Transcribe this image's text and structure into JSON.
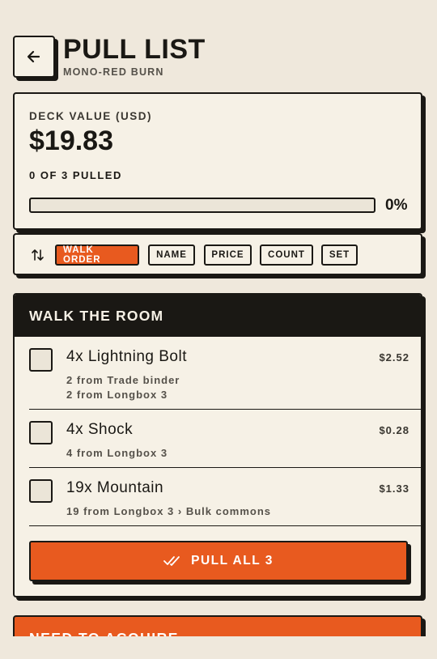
{
  "header": {
    "title": "PULL LIST",
    "subtitle": "MONO-RED BURN"
  },
  "summary": {
    "value_label": "DECK VALUE (USD)",
    "value": "$19.83",
    "pulled_text": "0 OF 3 PULLED",
    "progress_fraction": 0,
    "percent_text": "0%"
  },
  "sort": {
    "options": [
      "WALK ORDER",
      "NAME",
      "PRICE",
      "COUNT",
      "SET"
    ],
    "active": "WALK ORDER"
  },
  "walk": {
    "title": "WALK THE ROOM",
    "items": [
      {
        "name": "4x Lightning Bolt",
        "price": "$2.52",
        "locations": [
          "2 from Trade binder",
          "2 from Longbox 3"
        ],
        "checked": false
      },
      {
        "name": "4x Shock",
        "price": "$0.28",
        "locations": [
          "4 from Longbox 3"
        ],
        "checked": false
      },
      {
        "name": "19x Mountain",
        "price": "$1.33",
        "locations": [
          "19 from Longbox 3 › Bulk commons"
        ],
        "checked": false
      }
    ],
    "pull_all_label": "PULL ALL 3"
  },
  "acquire": {
    "title": "NEED TO ACQUIRE"
  },
  "colors": {
    "accent": "#e85a1f",
    "background": "#efe8dc",
    "card": "#f6f1e6",
    "ink": "#1a1814"
  }
}
